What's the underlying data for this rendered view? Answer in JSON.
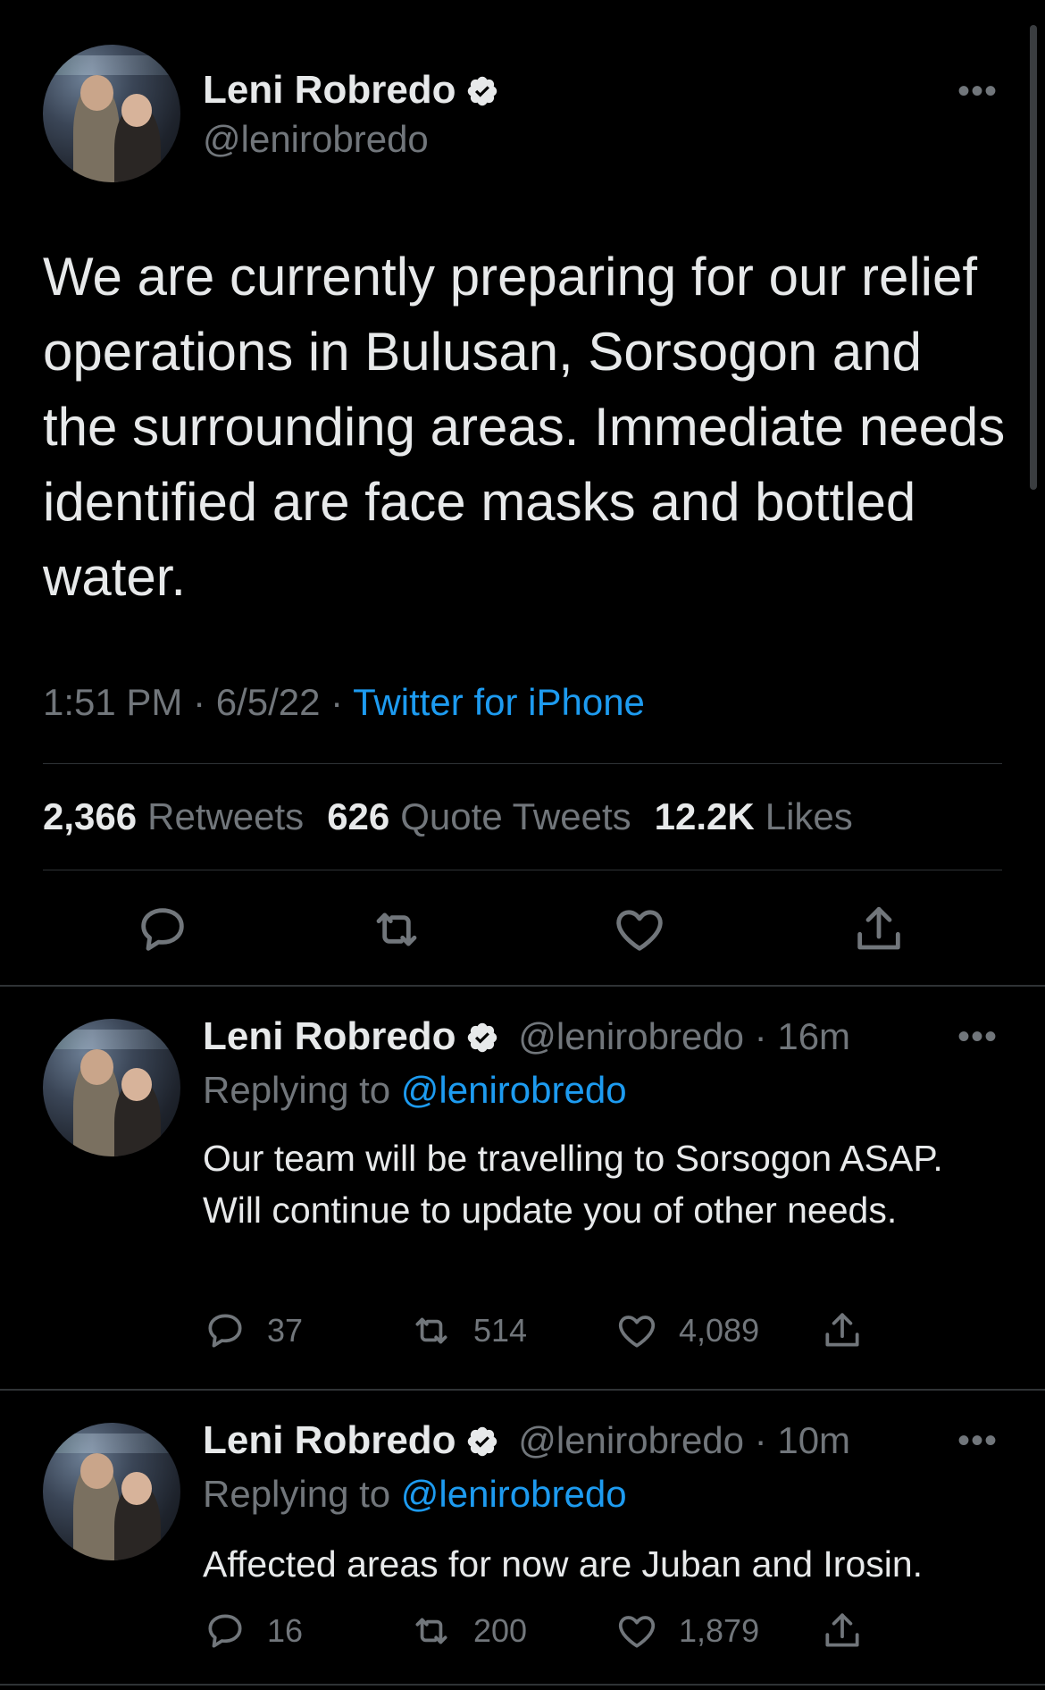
{
  "main_tweet": {
    "author_name": "Leni Robredo",
    "handle": "@lenirobredo",
    "more_label": "•••",
    "text": "We are currently preparing for our relief operations in Bulusan, Sorsogon and the surrounding areas. Immediate needs identified are face masks and bottled water.",
    "time": "1:51 PM · 6/5/22 ·",
    "source": "Twitter for iPhone",
    "retweets_count": "2,366",
    "retweets_label": "Retweets",
    "quotes_count": "626",
    "quotes_label": "Quote Tweets",
    "likes_count": "12.2K",
    "likes_label": "Likes"
  },
  "replies": [
    {
      "author_name": "Leni Robredo",
      "handle_time": "@lenirobredo · 16m",
      "replying_prefix": "Replying to",
      "replying_handle": "@lenirobredo",
      "text": "Our team will be travelling to Sorsogon ASAP. Will continue to update you of other needs.",
      "reply_count": "37",
      "retweet_count": "514",
      "like_count": "4,089",
      "more_label": "•••"
    },
    {
      "author_name": "Leni Robredo",
      "handle_time": "@lenirobredo · 10m",
      "replying_prefix": "Replying to",
      "replying_handle": "@lenirobredo",
      "text": "Affected areas for now are Juban and Irosin.",
      "reply_count": "16",
      "retweet_count": "200",
      "like_count": "1,879",
      "more_label": "•••"
    }
  ],
  "icons": {
    "verified": "verified-badge-icon",
    "reply": "reply-bubble-icon",
    "retweet": "retweet-icon",
    "like": "heart-icon",
    "share": "share-icon"
  },
  "colors": {
    "background": "#000000",
    "text": "#e7e9ea",
    "secondary": "#71767b",
    "accent": "#1d9bf0",
    "divider": "#2f3336"
  }
}
